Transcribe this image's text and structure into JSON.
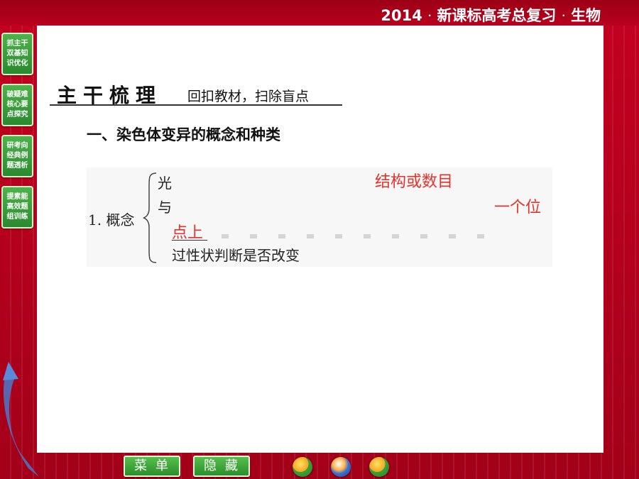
{
  "header": {
    "year": "2014",
    "course": "新课标高考总复习",
    "subject": "生物"
  },
  "side_nav": [
    {
      "lines": [
        "抓主干",
        "双基知",
        "识优化"
      ]
    },
    {
      "lines": [
        "破疑难",
        "核心要",
        "点探究"
      ]
    },
    {
      "lines": [
        "研考向",
        "经典例",
        "题透析"
      ]
    },
    {
      "lines": [
        "提素能",
        "高效题",
        "组训练"
      ]
    }
  ],
  "section": {
    "title": "主干梳理",
    "subtitle": "回扣教材，扫除盲点"
  },
  "heading": "一、染色体变异的概念和种类",
  "concept": {
    "label": "1. 概念",
    "line1": "光",
    "line2": "与",
    "red_top": "结构或数目",
    "red_right": "一个位",
    "red_point": "点上",
    "line4": "过性状判断是否改变"
  },
  "bottom": {
    "menu_label": "菜单",
    "hide_label": "隐藏"
  },
  "colors": {
    "background": "#b3001b",
    "button_green": "#3aa33a",
    "answer_red": "#e4322b"
  }
}
